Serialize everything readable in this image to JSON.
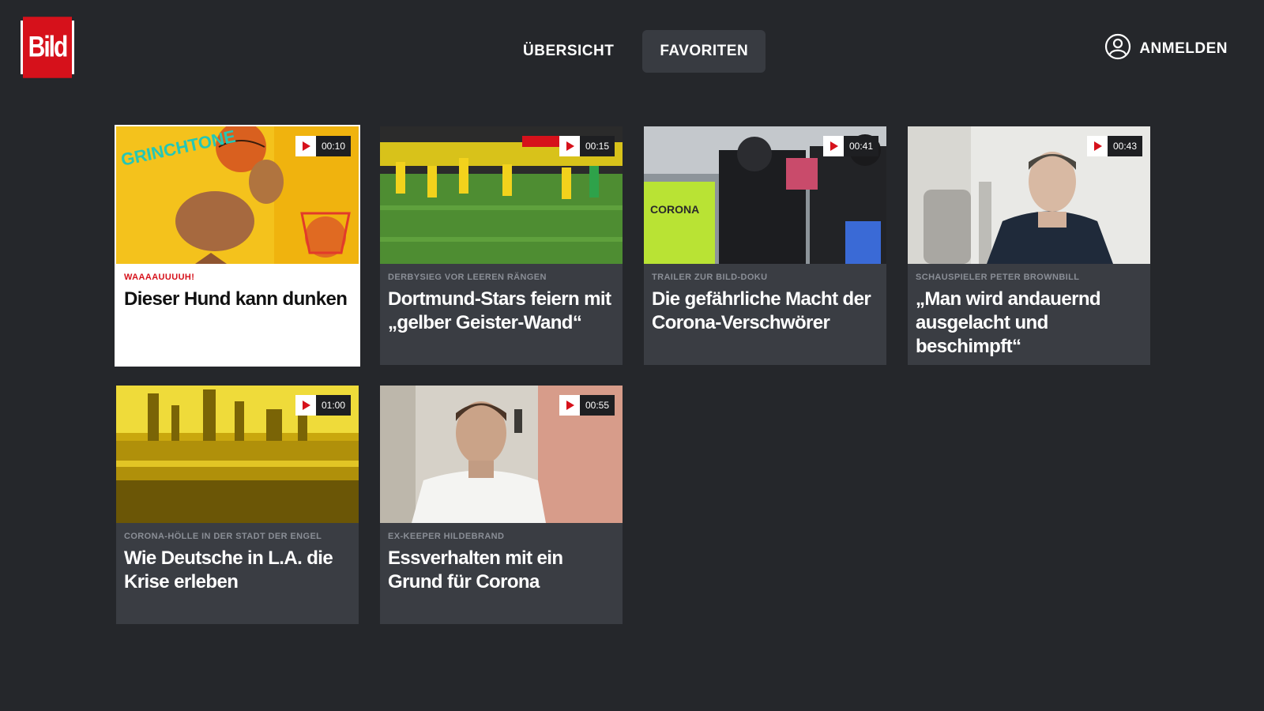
{
  "app": {
    "logo_text": "Bild",
    "brand_color": "#d6111b",
    "background": "#25272b"
  },
  "nav": {
    "tabs": [
      {
        "label": "ÜBERSICHT",
        "active": false
      },
      {
        "label": "FAVORITEN",
        "active": true
      }
    ]
  },
  "header": {
    "login_label": "ANMELDEN",
    "login_icon": "user-circle-icon"
  },
  "cards": [
    {
      "kicker": "WAAAAUUUUH!",
      "headline": "Dieser Hund kann dunken",
      "duration": "00:10",
      "focused": true
    },
    {
      "kicker": "DERBYSIEG VOR LEEREN RÄNGEN",
      "headline": "Dortmund-Stars feiern mit „gelber Geister-Wand“",
      "duration": "00:15",
      "focused": false
    },
    {
      "kicker": "TRAILER ZUR BILD-DOKU",
      "headline": "Die gefährliche Macht der Corona-Verschwörer",
      "duration": "00:41",
      "focused": false
    },
    {
      "kicker": "SCHAUSPIELER PETER BROWNBILL",
      "headline": "„Man wird andauernd ausgelacht und beschimpft“",
      "duration": "00:43",
      "focused": false
    },
    {
      "kicker": "CORONA-HÖLLE IN DER STADT DER ENGEL",
      "headline": "Wie Deutsche in L.A. die Krise erleben",
      "duration": "01:00",
      "focused": false
    },
    {
      "kicker": "EX-KEEPER HILDEBRAND",
      "headline": "Essverhalten mit ein Grund für Corona",
      "duration": "00:55",
      "focused": false
    }
  ]
}
